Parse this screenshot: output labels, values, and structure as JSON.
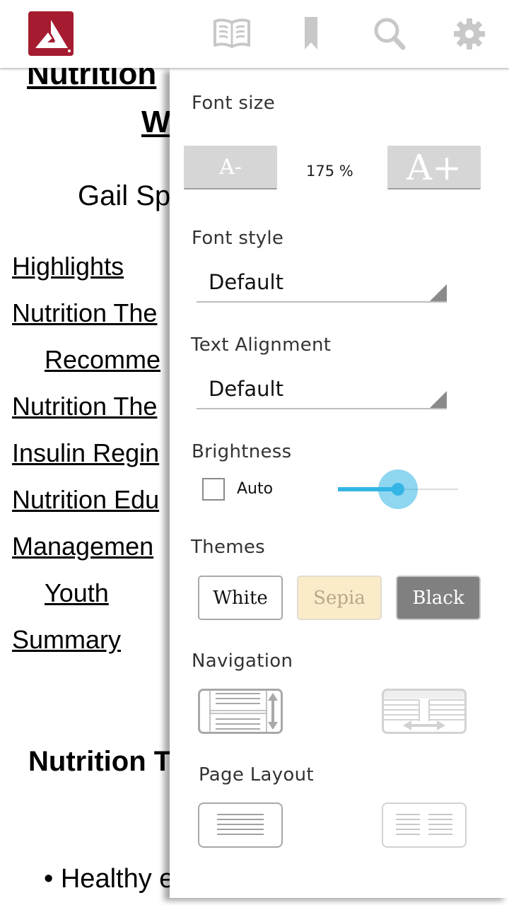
{
  "toolbar": {
    "logo": "app-logo",
    "icons": {
      "book": "open-book-icon",
      "bookmark": "bookmark-icon",
      "search": "search-icon",
      "settings": "gear-icon"
    },
    "icon_color": "#c8c8c8",
    "brand_color": "#a51c30"
  },
  "book": {
    "title_line1": "Nutrition",
    "title_line2": "W",
    "author": "Gail Sp",
    "toc": [
      {
        "label": "Highlights"
      },
      {
        "label": "Nutrition The"
      },
      {
        "label": "Recomme"
      },
      {
        "label": "Nutrition The"
      },
      {
        "label": "Insulin Regin"
      },
      {
        "label": "Nutrition Edu"
      },
      {
        "label": "Managemen"
      },
      {
        "label": "Youth"
      },
      {
        "label": "Summary"
      }
    ],
    "section_heading": "Nutrition T",
    "bullet_text": "• Healthy e"
  },
  "settings": {
    "font_size": {
      "label": "Font size",
      "decrease_label": "A-",
      "increase_label": "A+",
      "value": "175 %"
    },
    "font_style": {
      "label": "Font style",
      "selected": "Default"
    },
    "text_alignment": {
      "label": "Text Alignment",
      "selected": "Default"
    },
    "brightness": {
      "label": "Brightness",
      "auto_label": "Auto",
      "auto_checked": false,
      "level": 0.5,
      "accent_color": "#33b5e5"
    },
    "themes": {
      "label": "Themes",
      "options": [
        {
          "label": "White",
          "color": "#ffffff"
        },
        {
          "label": "Sepia",
          "color": "#fbecc9"
        },
        {
          "label": "Black",
          "color": "#808080"
        }
      ]
    },
    "navigation": {
      "label": "Navigation",
      "options": [
        {
          "name": "vertical-scroll",
          "selected": true
        },
        {
          "name": "horizontal-paging",
          "selected": false
        }
      ]
    },
    "page_layout": {
      "label": "Page Layout",
      "options": [
        {
          "name": "single-column",
          "selected": true
        },
        {
          "name": "two-column",
          "selected": false
        }
      ]
    }
  }
}
